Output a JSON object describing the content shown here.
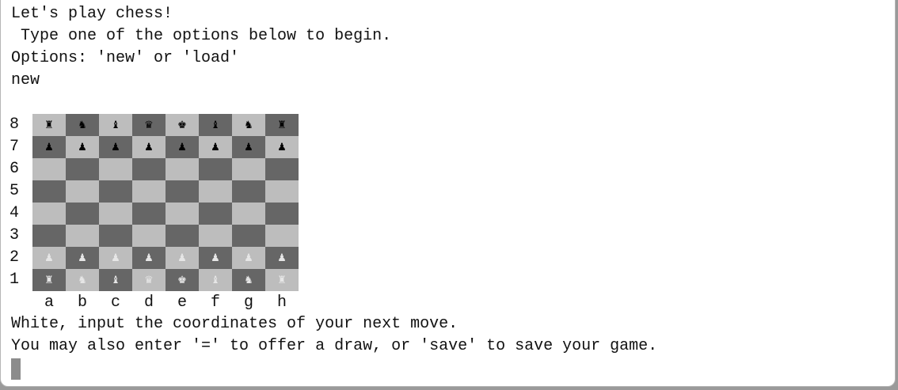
{
  "terminal": {
    "lines_top": [
      "Let's play chess!",
      " Type one of the options below to begin.",
      "Options: 'new' or 'load'",
      "new"
    ],
    "lines_bottom": [
      "White, input the coordinates of your next move.",
      "You may also enter '=' to offer a draw, or 'save' to save your game."
    ]
  },
  "board": {
    "rank_labels": [
      "8",
      "7",
      "6",
      "5",
      "4",
      "3",
      "2",
      "1"
    ],
    "file_labels": [
      "a",
      "b",
      "c",
      "d",
      "e",
      "f",
      "g",
      "h"
    ],
    "ranks": [
      "rnbqkbnr",
      "pppppppp",
      "........",
      "........",
      "........",
      "........",
      "PPPPPPPP",
      "RNBQKBNR"
    ],
    "colors": {
      "light_square": "#bdbdbd",
      "dark_square": "#666666",
      "black_piece": "#000000",
      "white_piece": "#e6e6e6"
    }
  }
}
